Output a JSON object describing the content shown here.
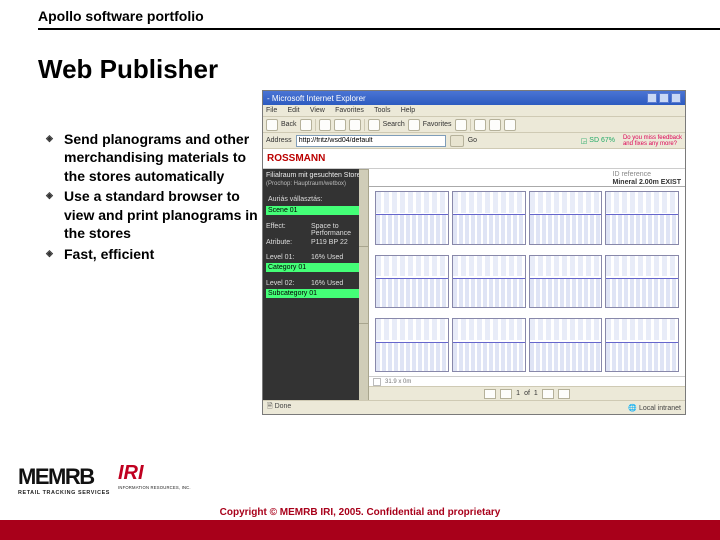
{
  "header": {
    "topic": "Apollo software portfolio"
  },
  "title": "Web Publisher",
  "bullets": [
    "Send planograms and other merchandising materials to the stores automatically",
    "Use a standard browser to view and print planograms in the stores",
    "Fast, efficient"
  ],
  "ie": {
    "title_suffix": " - Microsoft Internet Explorer",
    "menu": [
      "File",
      "Edit",
      "View",
      "Favorites",
      "Tools",
      "Help"
    ],
    "toolbar": {
      "back": "Back",
      "search": "Search",
      "favorites": "Favorites"
    },
    "address": {
      "label": "Address",
      "url": "http://fritz/wsd04/default",
      "go": "Go",
      "progress": "SD 67%",
      "feedback_line1": "Do you miss feedback",
      "feedback_line2": "and fixes any more?"
    },
    "brand": "ROSSMANN",
    "nav": {
      "header": "Filialraum mit gesuchten Store",
      "sub": "(Prochop: Hauptraum/wetbox)",
      "section_label": "Auriás vállasztás:",
      "scene": "Scene 01",
      "effect_label": "Effect:",
      "effect1": "Space to",
      "effect2": "Performance",
      "atrib_label": "Atribute:",
      "atrib1": "P119",
      "atrib2": "BP 22",
      "level1_k": "Level 01:",
      "level1_v": "16% Used",
      "cat_k": "Category",
      "cat_v": "01",
      "level2_k": "Level 02:",
      "level2_v": "16% Used",
      "subcat_k": "Subcategory",
      "subcat_v": "01"
    },
    "main": {
      "id_label": "ID reference",
      "id_line2": "Mineral 2.00m EXIST"
    },
    "ruler_val": "31.9 x 0m",
    "pager": {
      "page_of": "of",
      "current": "1",
      "total": "1"
    },
    "status": {
      "left": "Done",
      "right": "Local intranet"
    }
  },
  "footer": {
    "memrb": "MEMRB",
    "memrb_tag": "RETAIL TRACKING SERVICES",
    "iri": "IRI",
    "iri_tag": "INFORMATION RESOURCES, INC.",
    "copyright": "Copyright © MEMRB IRI, 2005. Confidential and proprietary"
  }
}
